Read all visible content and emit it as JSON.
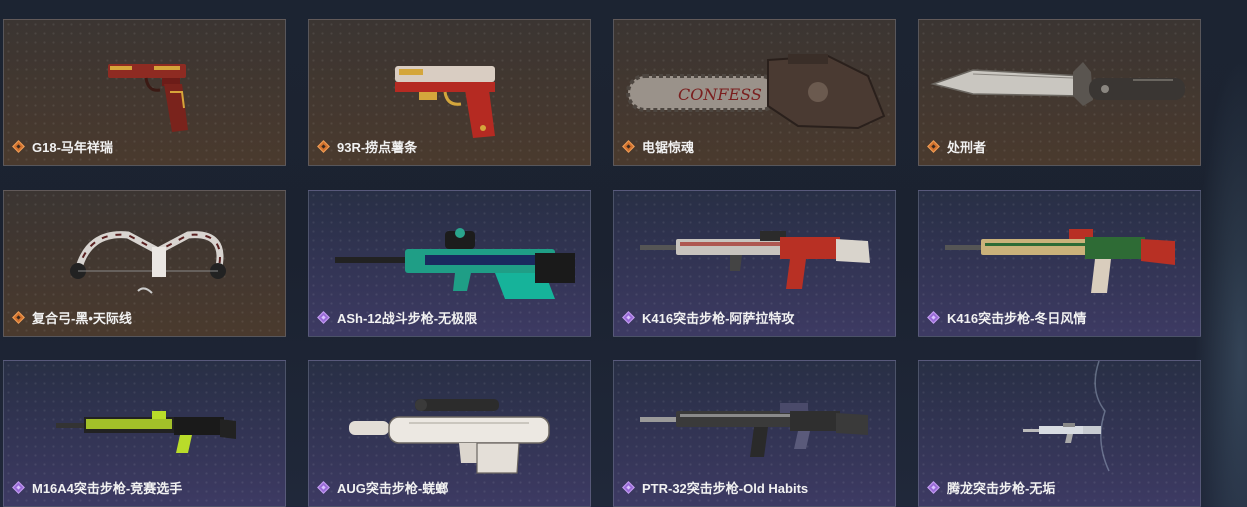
{
  "items": [
    {
      "name": "G18-马年祥瑞",
      "rarity": "gold",
      "weapon_icon": "pistol-icon"
    },
    {
      "name": "93R-捞点薯条",
      "rarity": "gold",
      "weapon_icon": "pistol-icon"
    },
    {
      "name": "电锯惊魂",
      "rarity": "gold",
      "weapon_icon": "chainsaw-icon"
    },
    {
      "name": "处刑者",
      "rarity": "gold",
      "weapon_icon": "knife-icon"
    },
    {
      "name": "复合弓-黑•天际线",
      "rarity": "gold",
      "weapon_icon": "compound-bow-icon"
    },
    {
      "name": "ASh-12战斗步枪-无极限",
      "rarity": "purple",
      "weapon_icon": "rifle-icon"
    },
    {
      "name": "K416突击步枪-阿萨拉特攻",
      "rarity": "purple",
      "weapon_icon": "rifle-icon"
    },
    {
      "name": "K416突击步枪-冬日风情",
      "rarity": "purple",
      "weapon_icon": "rifle-icon"
    },
    {
      "name": "M16A4突击步枪-竞赛选手",
      "rarity": "purple",
      "weapon_icon": "rifle-icon"
    },
    {
      "name": "AUG突击步枪-蜣螂",
      "rarity": "purple",
      "weapon_icon": "bullpup-rifle-icon"
    },
    {
      "name": "PTR-32突击步枪-Old Habits",
      "rarity": "purple",
      "weapon_icon": "rifle-icon"
    },
    {
      "name": "腾龙突击步枪-无垢",
      "rarity": "purple",
      "weapon_icon": "rifle-icon"
    }
  ],
  "colors": {
    "gold_accent": "#d3722d",
    "purple_accent": "#9a6bd8",
    "background": "#1c2432"
  }
}
